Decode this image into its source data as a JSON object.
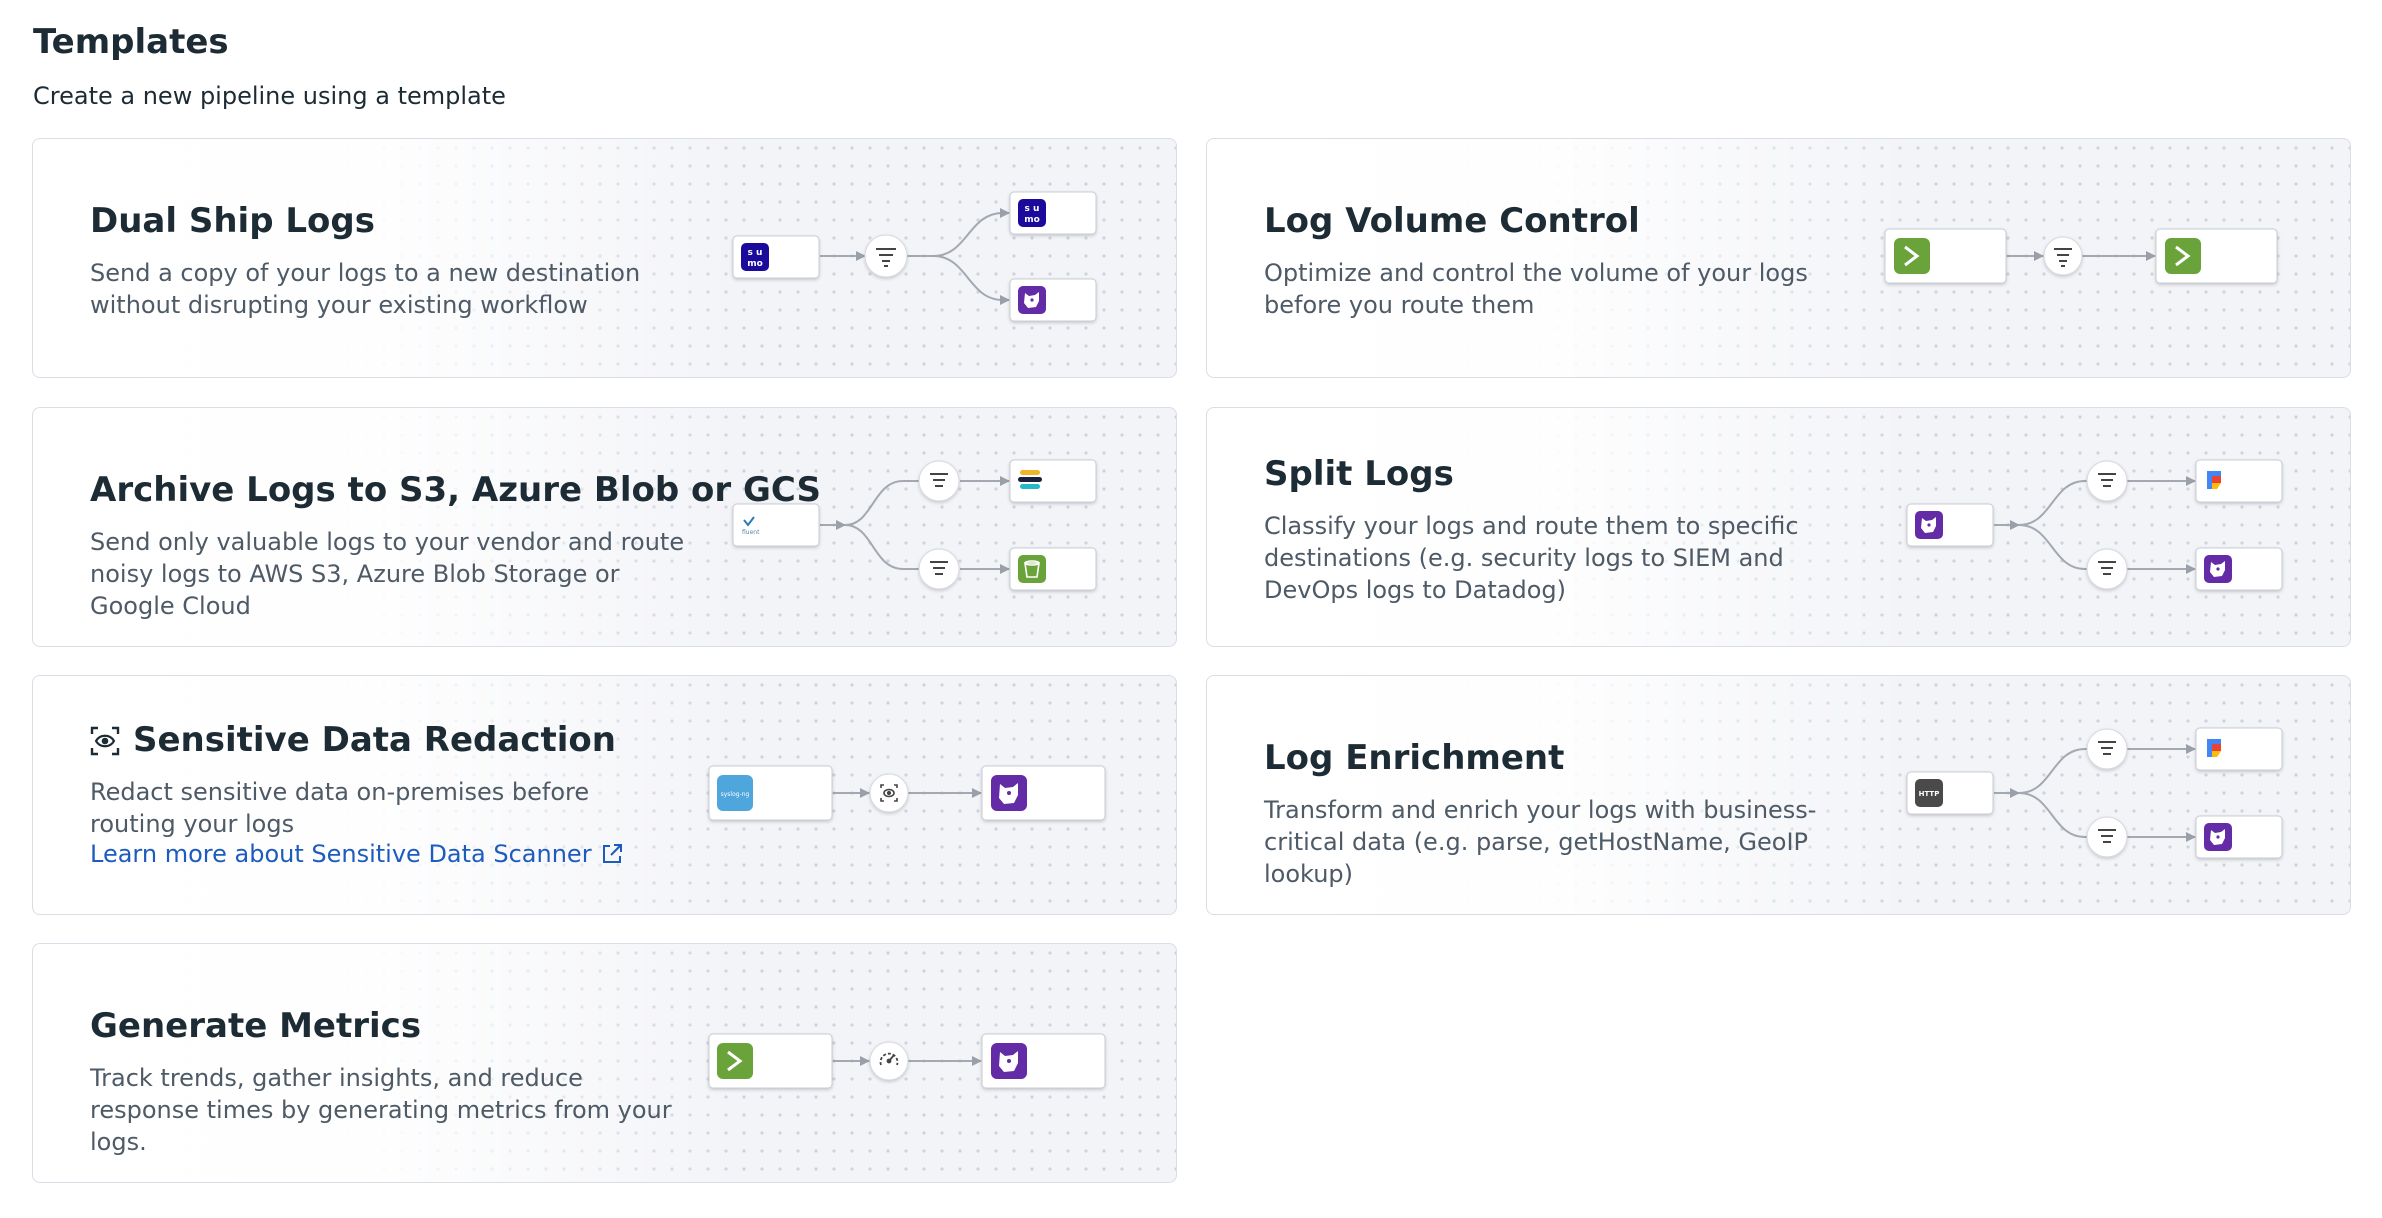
{
  "header": {
    "title": "Templates",
    "subtitle": "Create a new pipeline using a template"
  },
  "cards": [
    {
      "title": "Dual Ship Logs",
      "desc": "Send a copy of your logs to a new destination without disrupting your existing workflow",
      "source_icon": "sumo-logic-icon",
      "step_icons": [
        "filter-icon"
      ],
      "dest_icons": [
        "sumo-logic-icon",
        "datadog-icon"
      ]
    },
    {
      "title": "Log Volume Control",
      "desc": "Optimize and control the volume of your logs before you route them",
      "source_icon": "terminal-icon",
      "step_icons": [
        "filter-icon"
      ],
      "dest_icons": [
        "terminal-icon"
      ]
    },
    {
      "title": "Archive Logs to S3, Azure Blob or GCS",
      "desc": "Send only valuable logs to your vendor and route noisy logs to AWS S3, Azure Blob Storage or Google Cloud",
      "source_icon": "fluent-icon",
      "step_icons": [
        "filter-icon",
        "filter-icon"
      ],
      "dest_icons": [
        "elastic-icon",
        "s3-bucket-icon"
      ]
    },
    {
      "title": "Split Logs",
      "desc": "Classify your logs and route them to specific destinations (e.g. security logs to SIEM and DevOps logs to Datadog)",
      "source_icon": "datadog-icon",
      "step_icons": [
        "filter-icon",
        "filter-icon"
      ],
      "dest_icons": [
        "google-secops-icon",
        "datadog-icon"
      ]
    },
    {
      "title": "Sensitive Data Redaction",
      "desc": "Redact sensitive data on-premises before routing your logs",
      "link": "Learn more about Sensitive Data Scanner",
      "source_icon": "syslog-icon",
      "source_text": "syslog-ng",
      "step_icons": [
        "scanner-icon"
      ],
      "dest_icons": [
        "datadog-icon"
      ]
    },
    {
      "title": "Log Enrichment",
      "desc": "Transform and enrich your logs with business-critical data (e.g. parse, getHostName, GeoIP lookup)",
      "source_icon": "http-icon",
      "source_text": "HTTP",
      "step_icons": [
        "filter-icon",
        "filter-icon"
      ],
      "dest_icons": [
        "google-secops-icon",
        "datadog-icon"
      ]
    },
    {
      "title": "Generate Metrics",
      "desc": "Track trends, gather insights, and reduce response times by generating metrics from your logs.",
      "source_icon": "terminal-icon",
      "step_icons": [
        "gauge-icon"
      ],
      "dest_icons": [
        "datadog-icon"
      ]
    }
  ],
  "colors": {
    "title": "#1c2b34",
    "description": "#4e5a66",
    "link": "#1d5bbf",
    "card_border": "#dadde6",
    "sumo": "#1b0a9b",
    "datadog": "#632ca6",
    "terminal": "#6aa33a"
  }
}
